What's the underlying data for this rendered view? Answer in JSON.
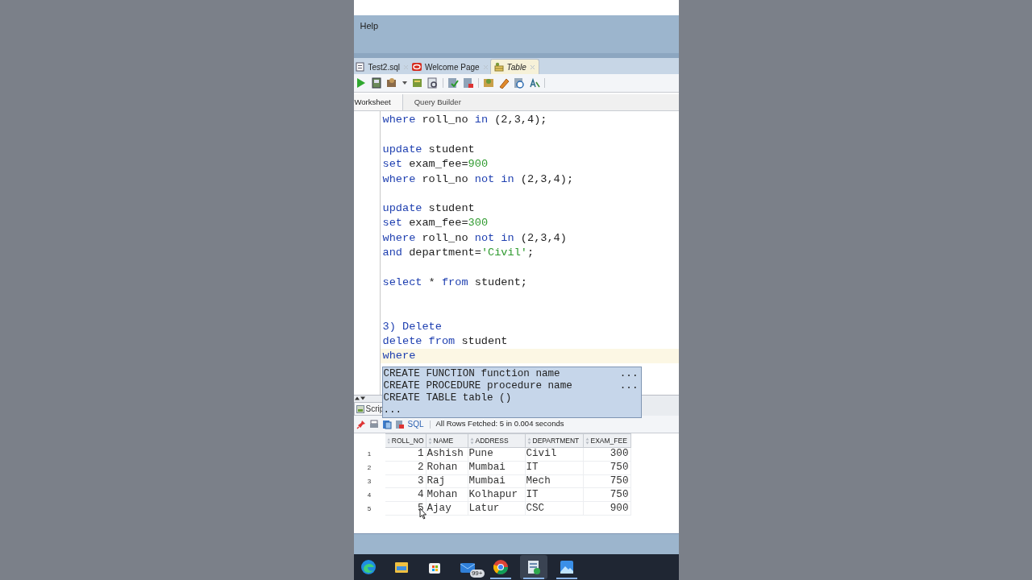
{
  "menu": {
    "items": [
      "Help"
    ]
  },
  "editor_tabs": [
    {
      "label": "Test2.sql",
      "kind": "sql",
      "selected": false
    },
    {
      "label": "Welcome Page",
      "kind": "oracle",
      "selected": false
    },
    {
      "label": "Table",
      "kind": "table",
      "selected": true
    }
  ],
  "sub_tabs": [
    {
      "label": "Worksheet",
      "selected": true
    },
    {
      "label": "Query Builder",
      "selected": false
    }
  ],
  "code_lines": [
    {
      "current": false,
      "tokens": [
        {
          "kind": "kw",
          "text": "where"
        },
        {
          "kind": "id",
          "text": " roll_no "
        },
        {
          "kind": "kw",
          "text": "in"
        },
        {
          "kind": "id",
          "text": " (2,3,4);"
        }
      ]
    },
    {
      "current": false
    },
    {
      "current": false,
      "tokens": [
        {
          "kind": "kw",
          "text": "update"
        },
        {
          "kind": "id",
          "text": " student"
        }
      ]
    },
    {
      "current": false,
      "tokens": [
        {
          "kind": "kw",
          "text": "set"
        },
        {
          "kind": "id",
          "text": " exam_fee="
        },
        {
          "kind": "num",
          "text": "900"
        }
      ]
    },
    {
      "current": false,
      "tokens": [
        {
          "kind": "kw",
          "text": "where"
        },
        {
          "kind": "id",
          "text": " roll_no "
        },
        {
          "kind": "kw",
          "text": "not in"
        },
        {
          "kind": "id",
          "text": " (2,3,4);"
        }
      ]
    },
    {
      "current": false
    },
    {
      "current": false,
      "tokens": [
        {
          "kind": "kw",
          "text": "update"
        },
        {
          "kind": "id",
          "text": " student"
        }
      ]
    },
    {
      "current": false,
      "tokens": [
        {
          "kind": "kw",
          "text": "set"
        },
        {
          "kind": "id",
          "text": " exam_fee="
        },
        {
          "kind": "num",
          "text": "300"
        }
      ]
    },
    {
      "current": false,
      "tokens": [
        {
          "kind": "kw",
          "text": "where"
        },
        {
          "kind": "id",
          "text": " roll_no "
        },
        {
          "kind": "kw",
          "text": "not in"
        },
        {
          "kind": "id",
          "text": " (2,3,4)"
        }
      ]
    },
    {
      "current": false,
      "tokens": [
        {
          "kind": "kw",
          "text": "and"
        },
        {
          "kind": "id",
          "text": " department="
        },
        {
          "kind": "str",
          "text": "'Civil'"
        },
        {
          "kind": "id",
          "text": ";"
        }
      ]
    },
    {
      "current": false
    },
    {
      "current": false,
      "tokens": [
        {
          "kind": "kw",
          "text": "select"
        },
        {
          "kind": "id",
          "text": " * "
        },
        {
          "kind": "kw",
          "text": "from"
        },
        {
          "kind": "id",
          "text": " student;"
        }
      ]
    },
    {
      "current": false
    },
    {
      "current": false
    },
    {
      "current": false,
      "tokens": [
        {
          "kind": "kw",
          "text": "3) Delete"
        }
      ]
    },
    {
      "current": false,
      "tokens": [
        {
          "kind": "kw",
          "text": "delete from"
        },
        {
          "kind": "id",
          "text": " student"
        }
      ]
    },
    {
      "current": true,
      "tokens": [
        {
          "kind": "kw",
          "text": "where"
        }
      ]
    }
  ],
  "autocomplete": [
    {
      "label": "CREATE FUNCTION function name",
      "more": "..."
    },
    {
      "label": "CREATE PROCEDURE procedure name",
      "more": "..."
    },
    {
      "label": "CREATE TABLE table ()"
    },
    {
      "label": "..."
    }
  ],
  "output_panel": {
    "tab": "Scrip",
    "sql_link": "SQL",
    "status": "All Rows Fetched: 5 in 0.004 seconds"
  },
  "table": {
    "columns": [
      "ROLL_NO",
      "NAME",
      "ADDRESS",
      "DEPARTMENT",
      "EXAM_FEE"
    ],
    "rows": [
      {
        "row_number": "1",
        "cells": [
          "1",
          "Ashish",
          "Pune",
          "Civil",
          "300"
        ]
      },
      {
        "row_number": "2",
        "cells": [
          "2",
          "Rohan",
          "Mumbai",
          "IT",
          "750"
        ]
      },
      {
        "row_number": "3",
        "cells": [
          "3",
          "Raj",
          "Mumbai",
          "Mech",
          "750"
        ]
      },
      {
        "row_number": "4",
        "cells": [
          "4",
          "Mohan",
          "Kolhapur",
          "IT",
          "750"
        ]
      },
      {
        "row_number": "5",
        "cells": [
          "5",
          "Ajay",
          "Latur",
          "CSC",
          "900"
        ]
      }
    ]
  },
  "taskbar": [
    {
      "kind": "edge",
      "running": false,
      "selected": false
    },
    {
      "kind": "folder",
      "running": false,
      "selected": false
    },
    {
      "kind": "store",
      "running": false,
      "selected": false
    },
    {
      "kind": "mail",
      "badge": "99+",
      "running": false,
      "selected": false
    },
    {
      "kind": "chrome",
      "running": true,
      "selected": false
    },
    {
      "kind": "app",
      "running": true,
      "selected": true
    },
    {
      "kind": "photos",
      "running": true,
      "selected": false
    }
  ]
}
